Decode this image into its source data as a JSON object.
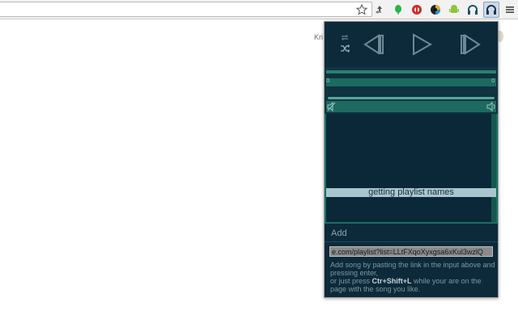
{
  "browser": {
    "icons": [
      "bookmark-star-icon",
      "recycle-icon",
      "green-leaf-icon",
      "red-shield-icon",
      "color-wheel-icon",
      "android-icon",
      "headphones-icon",
      "headphones-active-icon",
      "menu-icon"
    ]
  },
  "page": {
    "partial_text": "Kri"
  },
  "player": {
    "controls": [
      "repeat-icon",
      "shuffle-icon",
      "previous-icon",
      "play-icon",
      "next-icon"
    ],
    "progress": {
      "left_label": "0",
      "right_label": "0"
    },
    "status": "getting playlist names"
  },
  "add": {
    "label": "Add",
    "input_value": "e.com/playlist?list=LLtFXqoXyxgsa6xKul3wzlQ",
    "help_line1": "Add song by pasting the link in the input above and pressing enter,",
    "help_line2_prefix": "or just press ",
    "shortcut": "Ctr+Shift+L",
    "help_line2_suffix": " while your are on the page with the song you like."
  },
  "colors": {
    "popup_bg": "#0c2a3a",
    "accent_teal": "#1c6a60",
    "status_bg": "#a9c6cf"
  }
}
